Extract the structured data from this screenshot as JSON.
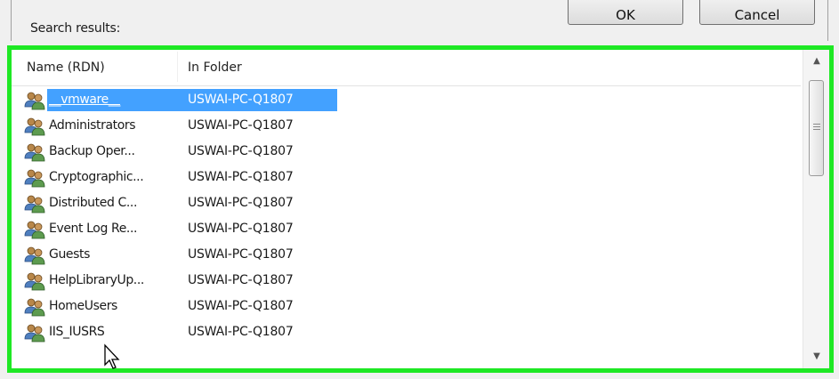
{
  "dialog": {
    "search_results_label": "Search results:",
    "ok_label": "OK",
    "cancel_label": "Cancel"
  },
  "list": {
    "columns": [
      "Name (RDN)",
      "In Folder"
    ],
    "selected_index": 0,
    "rows": [
      {
        "name": "__vmware__",
        "folder": "USWAI-PC-Q1807",
        "icon": "group-icon"
      },
      {
        "name": "Administrators",
        "folder": "USWAI-PC-Q1807",
        "icon": "group-icon"
      },
      {
        "name": "Backup Oper...",
        "folder": "USWAI-PC-Q1807",
        "icon": "group-icon"
      },
      {
        "name": "Cryptographic...",
        "folder": "USWAI-PC-Q1807",
        "icon": "group-icon"
      },
      {
        "name": "Distributed C...",
        "folder": "USWAI-PC-Q1807",
        "icon": "group-icon"
      },
      {
        "name": "Event Log Re...",
        "folder": "USWAI-PC-Q1807",
        "icon": "group-icon"
      },
      {
        "name": "Guests",
        "folder": "USWAI-PC-Q1807",
        "icon": "group-icon"
      },
      {
        "name": "HelpLibraryUp...",
        "folder": "USWAI-PC-Q1807",
        "icon": "group-icon"
      },
      {
        "name": "HomeUsers",
        "folder": "USWAI-PC-Q1807",
        "icon": "group-icon"
      },
      {
        "name": "IIS_IUSRS",
        "folder": "USWAI-PC-Q1807",
        "icon": "group-icon"
      }
    ]
  },
  "colors": {
    "highlight_border": "#1ee824",
    "selection": "#3399ff"
  }
}
